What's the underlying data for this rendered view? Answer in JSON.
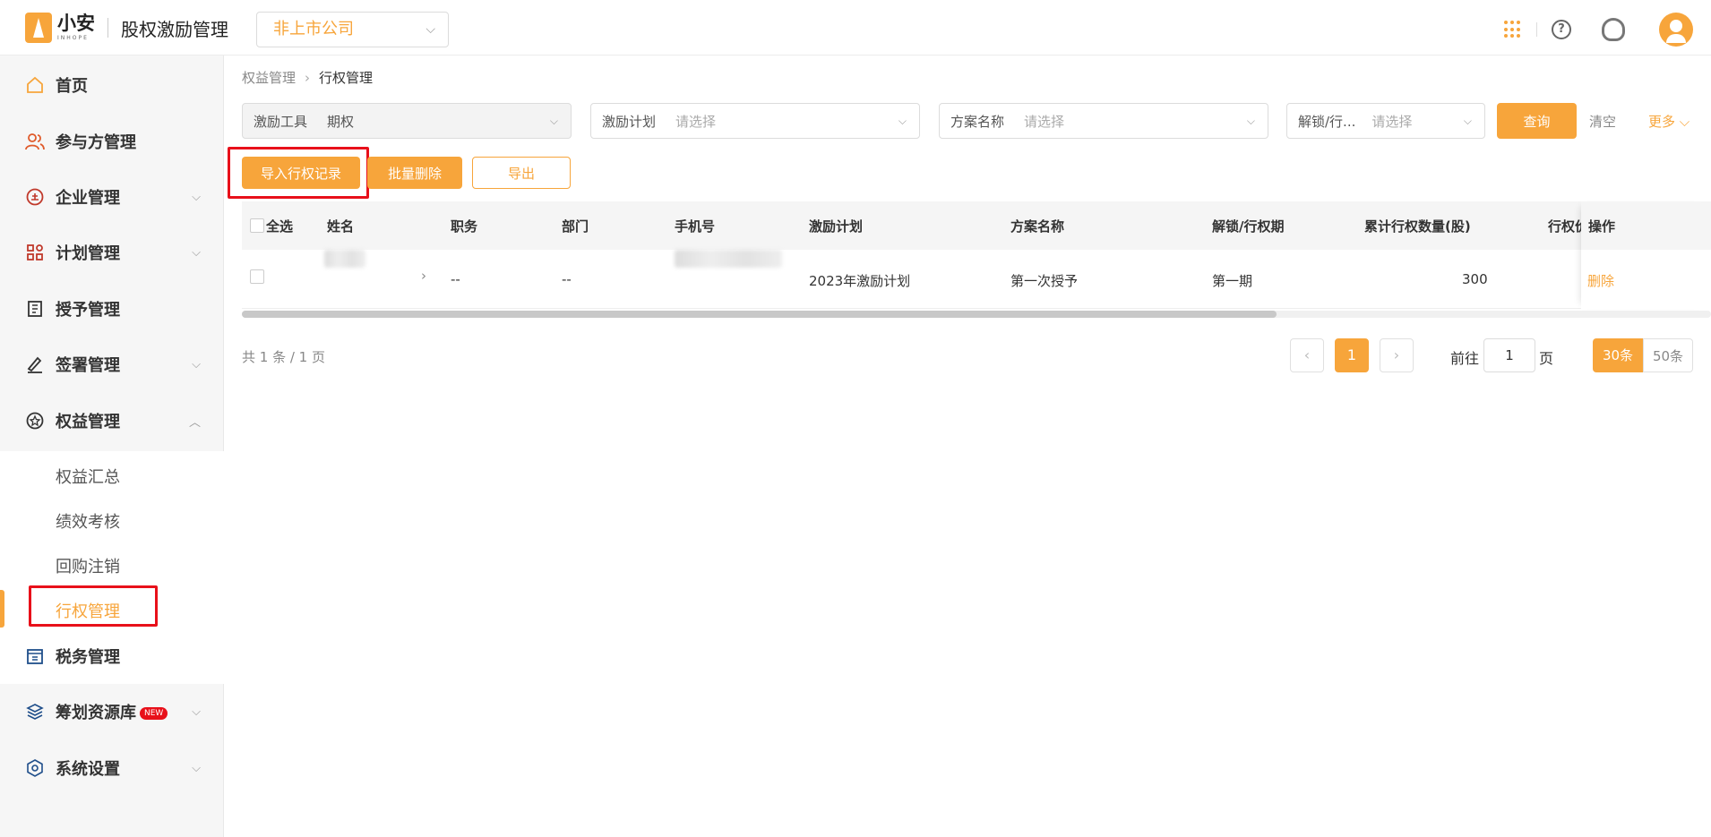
{
  "brand": {
    "name": "小安",
    "sub": "INHOPE",
    "app_title": "股权激励管理"
  },
  "company_select": {
    "value": "非上市公司"
  },
  "sidebar": {
    "items": [
      {
        "label": "首页",
        "icon": "home-icon"
      },
      {
        "label": "参与方管理",
        "icon": "users-icon"
      },
      {
        "label": "企业管理",
        "icon": "company-icon"
      },
      {
        "label": "计划管理",
        "icon": "plan-icon"
      },
      {
        "label": "授予管理",
        "icon": "grant-icon"
      },
      {
        "label": "签署管理",
        "icon": "sign-icon"
      },
      {
        "label": "权益管理",
        "icon": "equity-icon"
      },
      {
        "label": "税务管理",
        "icon": "tax-icon"
      },
      {
        "label": "筹划资源库",
        "icon": "layers-icon",
        "badge": "NEW"
      },
      {
        "label": "系统设置",
        "icon": "settings-icon"
      }
    ],
    "sub_items": [
      "权益汇总",
      "绩效考核",
      "回购注销",
      "行权管理"
    ]
  },
  "breadcrumb": {
    "parent": "权益管理",
    "current": "行权管理"
  },
  "filters": {
    "tool": {
      "label": "激励工具",
      "value": "期权"
    },
    "plan": {
      "label": "激励计划",
      "placeholder": "请选择"
    },
    "scheme": {
      "label": "方案名称",
      "placeholder": "请选择"
    },
    "period": {
      "label": "解锁/行...",
      "placeholder": "请选择"
    },
    "query_label": "查询",
    "clear_label": "清空",
    "more_label": "更多"
  },
  "actions": {
    "import_label": "导入行权记录",
    "batch_delete_label": "批量删除",
    "export_label": "导出"
  },
  "table": {
    "select_all": "全选",
    "columns": [
      "姓名",
      "职务",
      "部门",
      "手机号",
      "激励计划",
      "方案名称",
      "解锁/行权期",
      "累计行权数量(股)",
      "行权价",
      "操作"
    ],
    "rows": [
      {
        "position": "--",
        "department": "--",
        "plan": "2023年激励计划",
        "scheme": "第一次授予",
        "period": "第一期",
        "quantity": "300",
        "op": "删除"
      }
    ]
  },
  "pagination": {
    "total": "共 1 条 / 1 页",
    "current": "1",
    "goto_prefix": "前往",
    "goto_value": "1",
    "goto_suffix": "页",
    "sizes": [
      "30条",
      "50条"
    ]
  },
  "colors": {
    "accent": "#f7a53b",
    "highlight": "#e8101a"
  }
}
